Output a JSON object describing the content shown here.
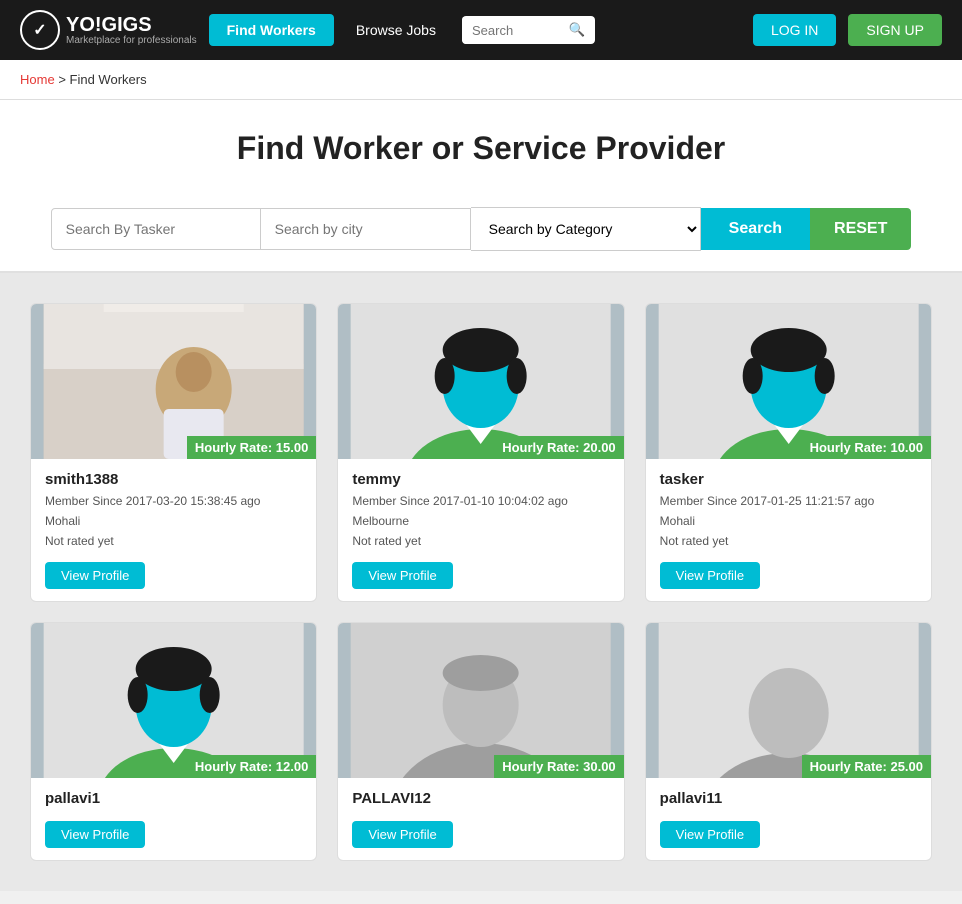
{
  "header": {
    "logo_icon": "✓",
    "logo_text": "YO!GIGS",
    "logo_sub": "Marketplace for professionals",
    "find_workers_label": "Find Workers",
    "browse_jobs_label": "Browse Jobs",
    "search_placeholder": "Search",
    "login_label": "LOG IN",
    "signup_label": "SIGN UP"
  },
  "breadcrumb": {
    "home": "Home",
    "separator": ">",
    "current": "Find Workers"
  },
  "page": {
    "title": "Find Worker or Service Provider"
  },
  "search": {
    "tasker_placeholder": "Search By Tasker",
    "city_placeholder": "Search by city",
    "category_placeholder": "Search by Category",
    "search_label": "Search",
    "reset_label": "RESET"
  },
  "workers": [
    {
      "username": "smith1388",
      "member_since": "Member Since 2017-03-20 15:38:45 ago",
      "city": "Mohali",
      "rating": "Not rated yet",
      "hourly_rate": "Hourly Rate: 15.00",
      "view_profile": "View Profile",
      "avatar_type": "photo"
    },
    {
      "username": "temmy",
      "member_since": "Member Since 2017-01-10 10:04:02 ago",
      "city": "Melbourne",
      "rating": "Not rated yet",
      "hourly_rate": "Hourly Rate: 20.00",
      "view_profile": "View Profile",
      "avatar_type": "cyan"
    },
    {
      "username": "tasker",
      "member_since": "Member Since 2017-01-25 11:21:57 ago",
      "city": "Mohali",
      "rating": "Not rated yet",
      "hourly_rate": "Hourly Rate: 10.00",
      "view_profile": "View Profile",
      "avatar_type": "cyan"
    },
    {
      "username": "pallavi1",
      "member_since": "",
      "city": "",
      "rating": "",
      "hourly_rate": "Hourly Rate: 12.00",
      "view_profile": "View Profile",
      "avatar_type": "cyan"
    },
    {
      "username": "PALLAVI12",
      "member_since": "",
      "city": "",
      "rating": "",
      "hourly_rate": "Hourly Rate: 30.00",
      "view_profile": "View Profile",
      "avatar_type": "gray_photo"
    },
    {
      "username": "pallavi11",
      "member_since": "",
      "city": "",
      "rating": "",
      "hourly_rate": "Hourly Rate: 25.00",
      "view_profile": "View Profile",
      "avatar_type": "gray"
    }
  ],
  "colors": {
    "cyan": "#00bcd4",
    "green": "#4caf50",
    "dark": "#1a1a1a",
    "red": "#e53935"
  }
}
